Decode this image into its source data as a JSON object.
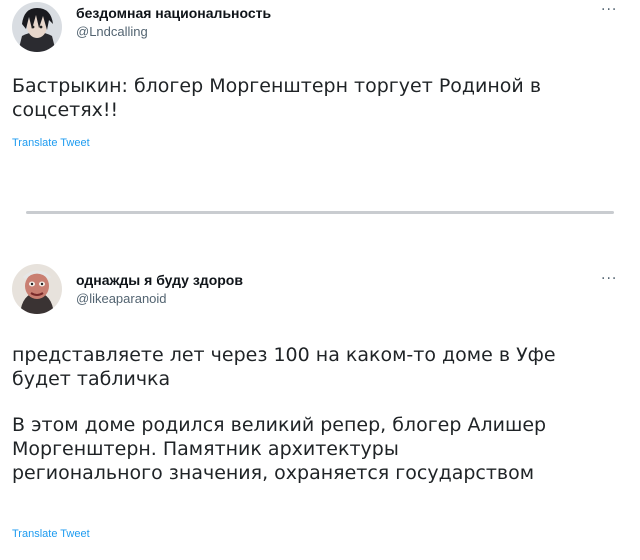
{
  "tweets": [
    {
      "display_name": "бездомная национальность",
      "handle": "@Lndcalling",
      "more": "···",
      "text_lines": [
        "Бастрыкин: блогер Моргенштерн торгует Родиной в",
        "соцсетях!!"
      ],
      "translate": "Translate Tweet",
      "avatar_icon": "avatar-photo-dark-hair-icon"
    },
    {
      "display_name": "однажды я буду здоров",
      "handle": "@likeaparanoid",
      "more": "···",
      "paragraph1_lines": [
        "представляете лет через 100 на каком-то доме в Уфе",
        "будет табличка"
      ],
      "paragraph2_lines": [
        "В этом доме родился великий репер, блогер Алишер",
        "Моргенштерн. Памятник архитектуры",
        "регионального значения, охраняется государством"
      ],
      "translate": "Translate Tweet",
      "avatar_icon": "avatar-photo-red-face-icon"
    }
  ],
  "colors": {
    "link": "#1d9bf0",
    "secondary_text": "#536471",
    "divider": "#c9ccd0"
  }
}
